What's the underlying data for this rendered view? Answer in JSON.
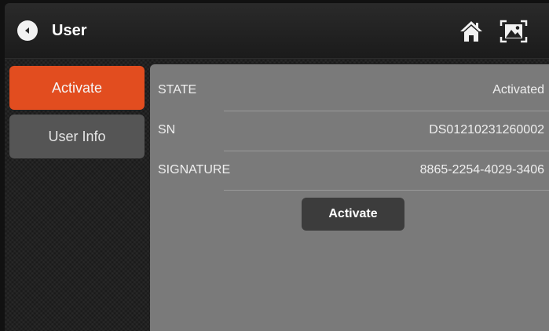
{
  "header": {
    "title": "User"
  },
  "icons": {
    "back": "back-arrow-icon",
    "home": "home-icon",
    "screenshot": "screenshot-icon"
  },
  "sidebar": {
    "items": [
      {
        "label": "Activate",
        "active": true
      },
      {
        "label": "User Info",
        "active": false
      }
    ]
  },
  "info": {
    "rows": [
      {
        "label": "STATE",
        "value": "Activated"
      },
      {
        "label": "SN",
        "value": "DS01210231260002"
      },
      {
        "label": "SIGNATURE",
        "value": "8865-2254-4029-3406"
      }
    ],
    "button_label": "Activate"
  },
  "colors": {
    "accent": "#e24d1f",
    "panel": "#7a7a7a",
    "tab_inactive": "#555555",
    "button": "#3c3c3c"
  }
}
